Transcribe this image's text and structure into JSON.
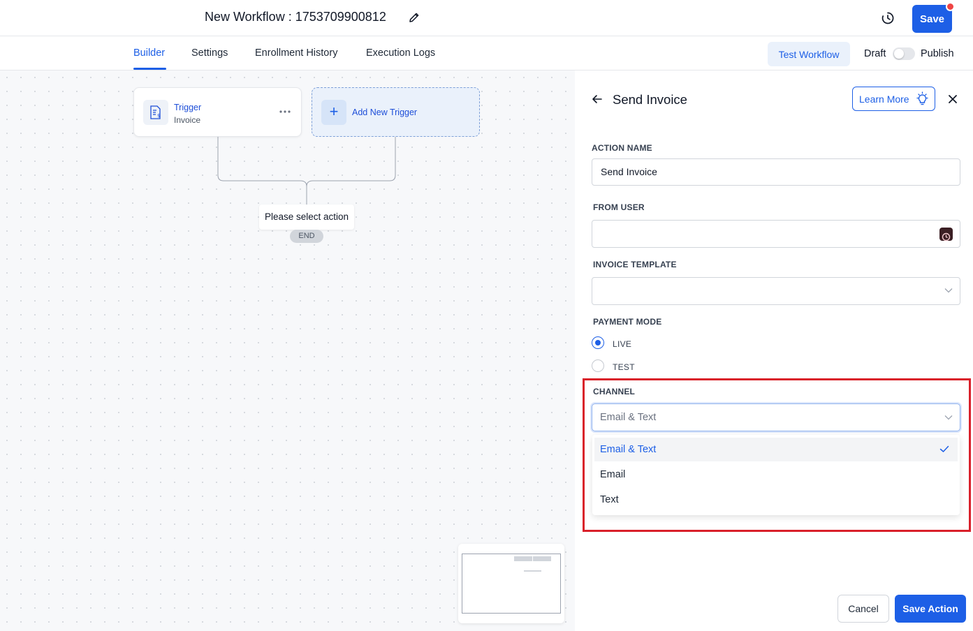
{
  "header": {
    "workflow_title": "New Workflow : 1753709900812",
    "save_label": "Save",
    "icons": {
      "edit": "pencil-icon",
      "history": "history-clock-icon"
    },
    "save_indicator_color": "#ef4444"
  },
  "tabs": [
    {
      "label": "Builder",
      "active": true
    },
    {
      "label": "Settings",
      "active": false
    },
    {
      "label": "Enrollment History",
      "active": false
    },
    {
      "label": "Execution Logs",
      "active": false
    }
  ],
  "toolbar": {
    "test_workflow_label": "Test Workflow",
    "draft_label": "Draft",
    "publish_label": "Publish",
    "published": false
  },
  "canvas": {
    "trigger": {
      "title": "Trigger",
      "subtitle": "Invoice",
      "icon": "invoice-icon"
    },
    "add_trigger_label": "Add New Trigger",
    "select_action_label": "Please select action",
    "end_label": "END"
  },
  "panel": {
    "title": "Send Invoice",
    "learn_more_label": "Learn More",
    "action_name": {
      "label": "ACTION NAME",
      "value": "Send Invoice"
    },
    "from_user": {
      "label": "FROM USER",
      "value": ""
    },
    "invoice_template": {
      "label": "INVOICE TEMPLATE",
      "value": ""
    },
    "payment_mode": {
      "label": "PAYMENT MODE",
      "options": [
        {
          "label": "LIVE",
          "selected": true
        },
        {
          "label": "TEST",
          "selected": false
        }
      ]
    },
    "channel": {
      "label": "CHANNEL",
      "value": "Email & Text",
      "options": [
        {
          "label": "Email & Text",
          "selected": true
        },
        {
          "label": "Email",
          "selected": false
        },
        {
          "label": "Text",
          "selected": false
        }
      ]
    },
    "cancel_label": "Cancel",
    "save_action_label": "Save Action"
  },
  "colors": {
    "accent": "#1d5fe6",
    "highlight_border": "#d9202a"
  }
}
